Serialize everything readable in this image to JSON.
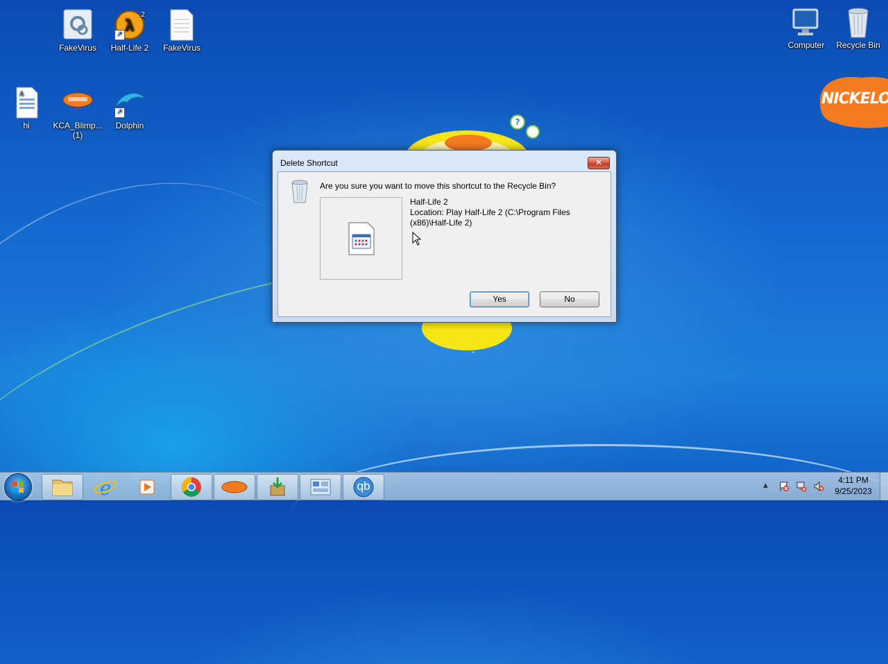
{
  "desktop": {
    "icons": [
      {
        "label": "FakeVirus"
      },
      {
        "label": "Half-Life 2"
      },
      {
        "label": "FakeVirus"
      },
      {
        "label": "hi"
      },
      {
        "label": "KCA_Blimp...\n(1)"
      },
      {
        "label": "Dolphin"
      },
      {
        "label": "Computer"
      },
      {
        "label": "Recycle Bin"
      }
    ],
    "background_logo_text": "NICKELOD"
  },
  "dialog": {
    "title": "Delete Shortcut",
    "close_label": "✕",
    "question": "Are you sure you want to move this shortcut to the Recycle Bin?",
    "item_name": "Half-Life 2",
    "item_location": "Location: Play Half-Life 2 (C:\\Program Files (x86)\\Half-Life 2)",
    "yes_label": "Yes",
    "no_label": "No"
  },
  "taskbar": {
    "tray": {
      "time": "4:11 PM",
      "date": "9/25/2023",
      "show_hidden_icon": "▲"
    },
    "buttons": [
      {
        "name": "file-explorer"
      },
      {
        "name": "internet-explorer"
      },
      {
        "name": "media-player"
      },
      {
        "name": "chrome"
      },
      {
        "name": "nickelodeon-blimp"
      },
      {
        "name": "installer"
      },
      {
        "name": "control-panel"
      },
      {
        "name": "qbittorrent",
        "label": "qb"
      }
    ]
  },
  "colors": {
    "accent": "#1b7ed9",
    "nick_orange": "#f47b20",
    "gadget_yellow": "#f7e617"
  }
}
